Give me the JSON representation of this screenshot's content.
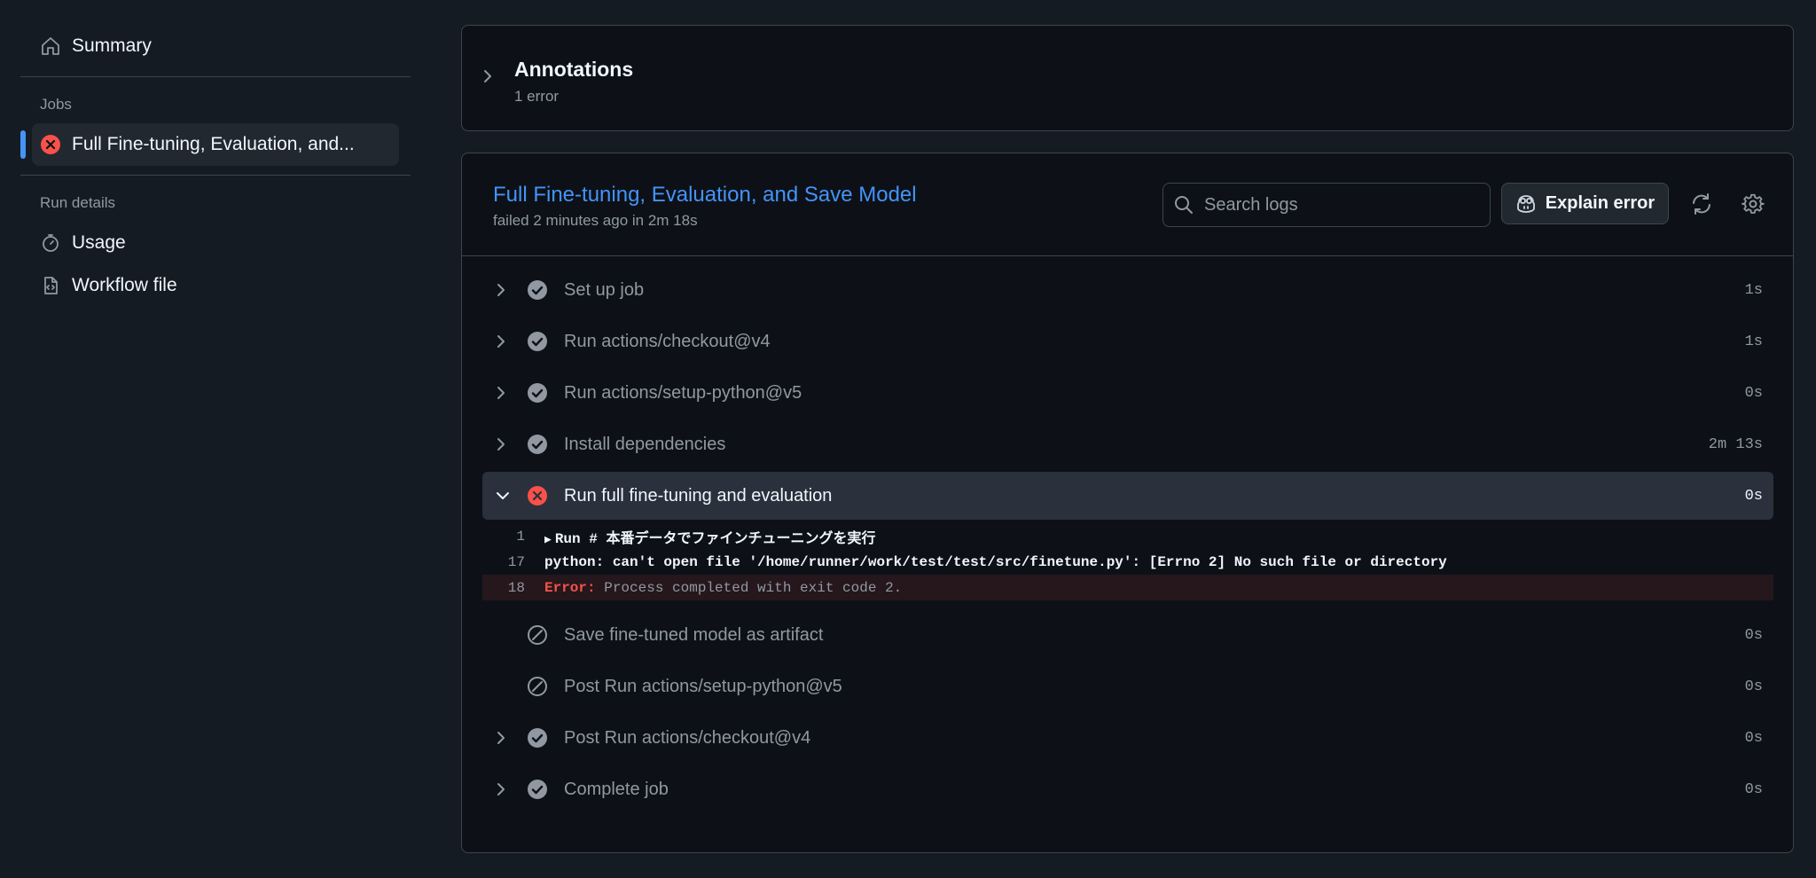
{
  "sidebar": {
    "summary_label": "Summary",
    "jobs_heading": "Jobs",
    "job_label": "Full Fine-tuning, Evaluation, and...",
    "run_details_heading": "Run details",
    "usage_label": "Usage",
    "workflow_file_label": "Workflow file"
  },
  "annotations": {
    "title": "Annotations",
    "subtitle": "1 error"
  },
  "job": {
    "title": "Full Fine-tuning, Evaluation, and Save Model",
    "subtitle": "failed 2 minutes ago in 2m 18s",
    "search_placeholder": "Search logs",
    "explain_label": "Explain error"
  },
  "steps": [
    {
      "name": "Set up job",
      "duration": "1s",
      "status": "success"
    },
    {
      "name": "Run actions/checkout@v4",
      "duration": "1s",
      "status": "success"
    },
    {
      "name": "Run actions/setup-python@v5",
      "duration": "0s",
      "status": "success"
    },
    {
      "name": "Install dependencies",
      "duration": "2m 13s",
      "status": "success"
    },
    {
      "name": "Run full fine-tuning and evaluation",
      "duration": "0s",
      "status": "failure"
    },
    {
      "name": "Save fine-tuned model as artifact",
      "duration": "0s",
      "status": "skipped"
    },
    {
      "name": "Post Run actions/setup-python@v5",
      "duration": "0s",
      "status": "skipped"
    },
    {
      "name": "Post Run actions/checkout@v4",
      "duration": "0s",
      "status": "success"
    },
    {
      "name": "Complete job",
      "duration": "0s",
      "status": "success"
    }
  ],
  "log": [
    {
      "line": "1",
      "text": "Run # 本番データでファインチューニングを実行"
    },
    {
      "line": "17",
      "text": "python: can't open file '/home/runner/work/test/test/src/finetune.py': [Errno 2] No such file or directory"
    },
    {
      "line": "18",
      "label": "Error:",
      "text": " Process completed with exit code 2."
    }
  ],
  "colors": {
    "accent": "#4493f8",
    "success": "#9198a1",
    "failure": "#f85149"
  }
}
